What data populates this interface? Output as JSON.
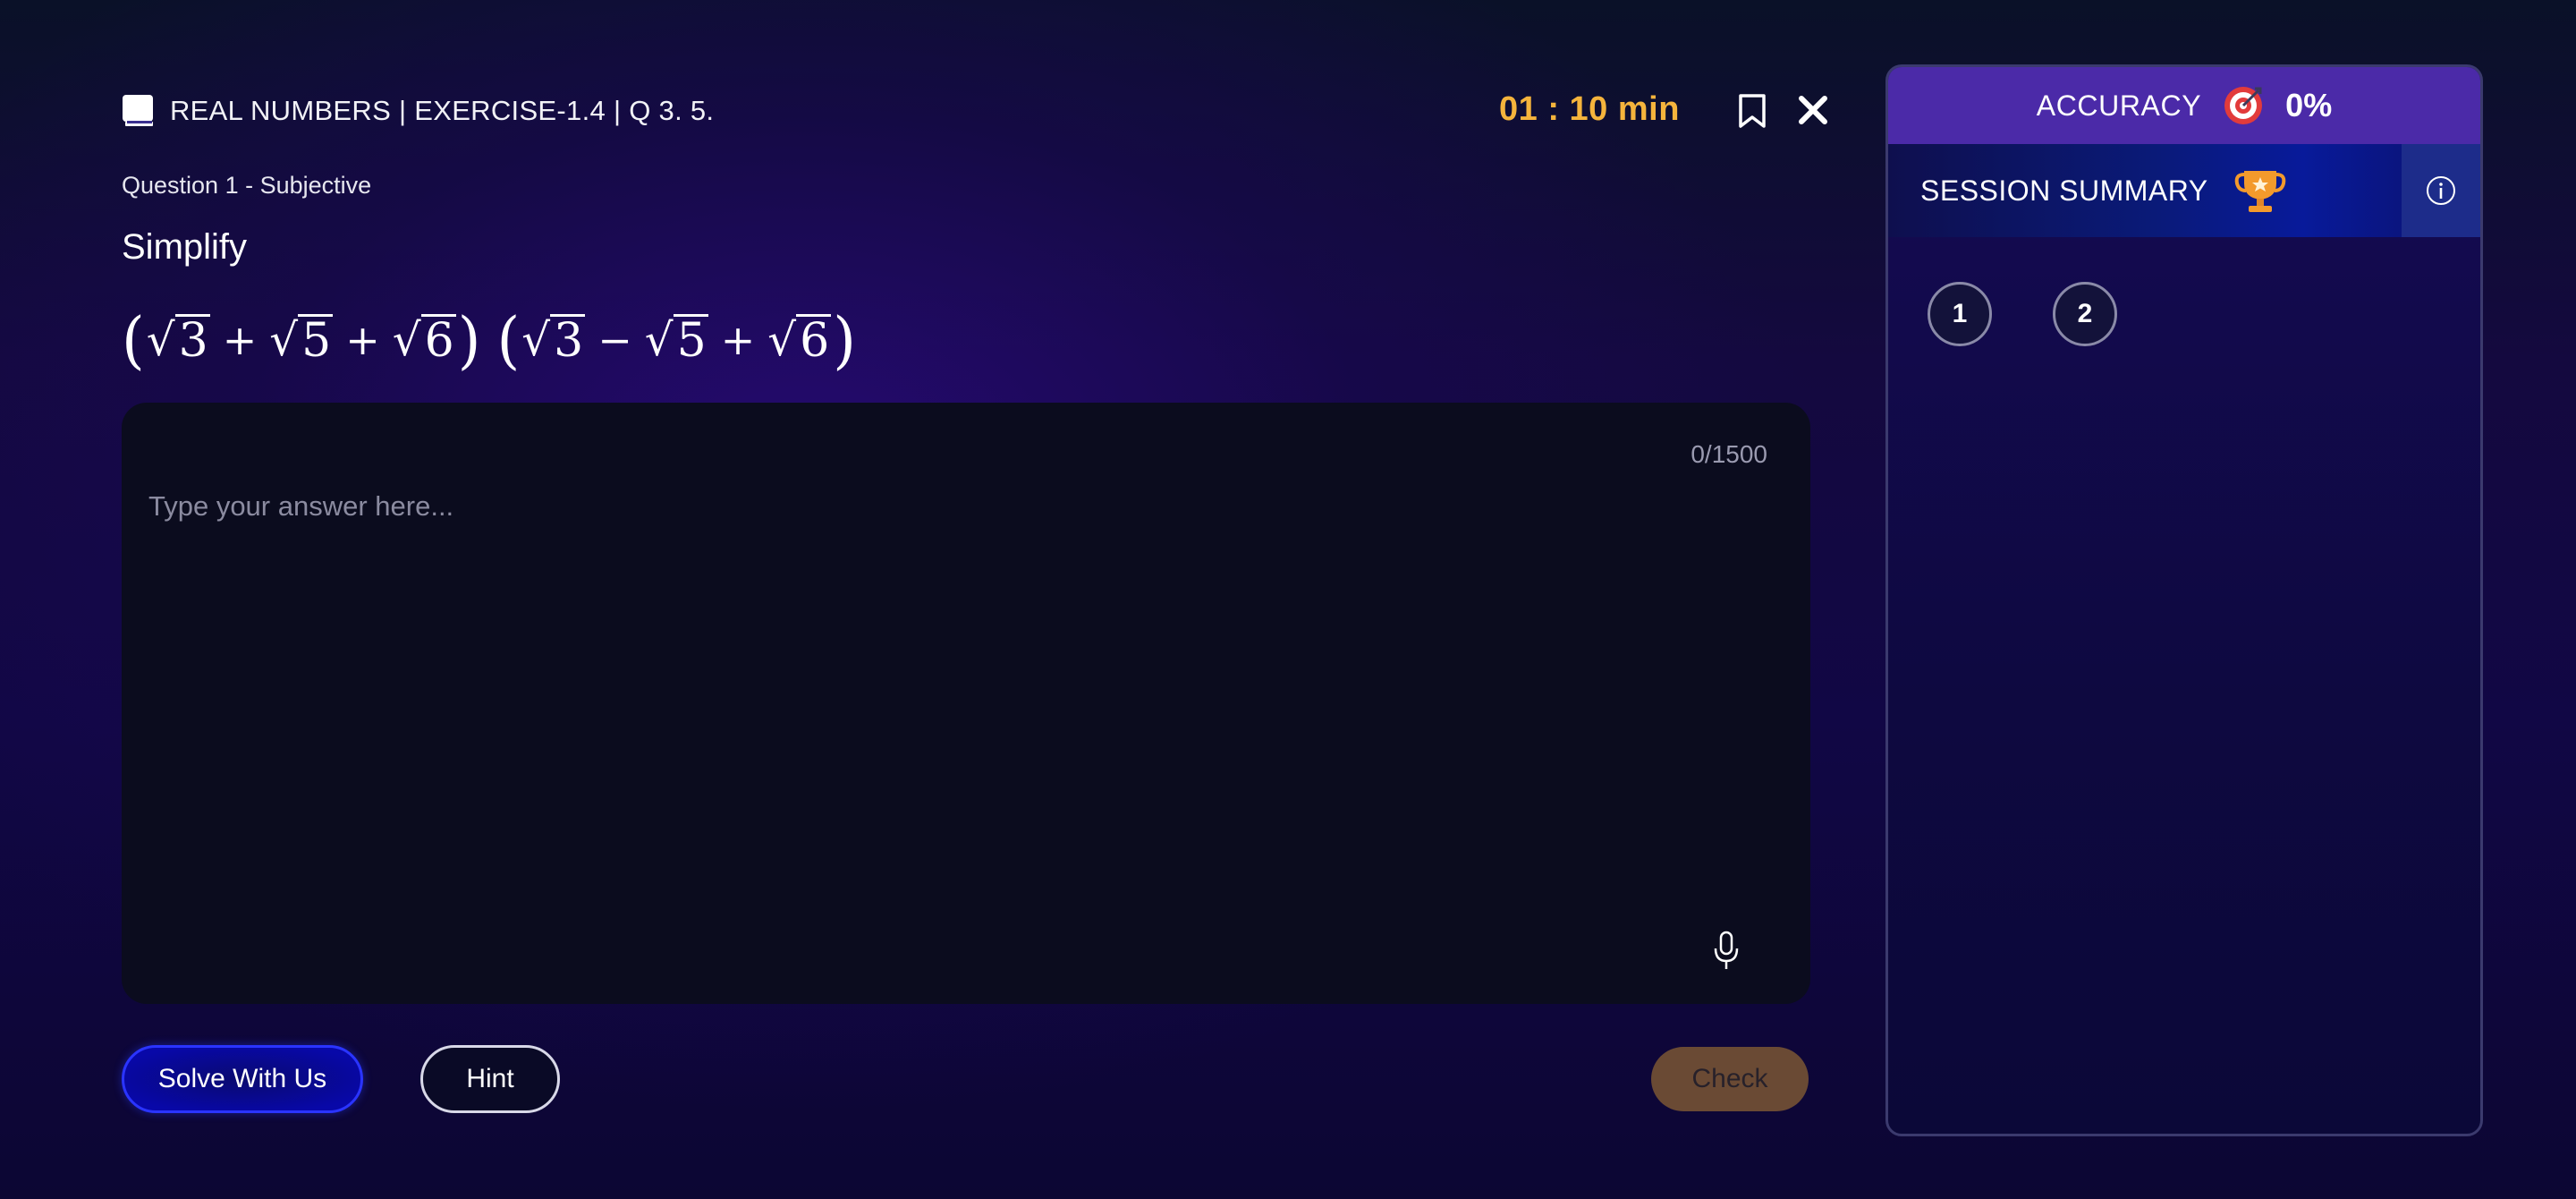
{
  "header": {
    "topic_icon": "book-icon",
    "topic": "REAL NUMBERS | EXERCISE-1.4 | Q 3. 5.",
    "timer": "01 : 10 min",
    "bookmark_icon": "bookmark-icon",
    "close_icon": "close-icon"
  },
  "question": {
    "type_label": "Question 1 - Subjective",
    "prompt": "Simplify",
    "expression": {
      "factor1": {
        "open": "(",
        "terms": [
          "3",
          "5",
          "6"
        ],
        "ops": [
          "+",
          "+"
        ],
        "close": ")"
      },
      "factor2": {
        "open": "(",
        "terms": [
          "3",
          "5",
          "6"
        ],
        "ops": [
          "−",
          "+"
        ],
        "close": ")"
      }
    }
  },
  "answer": {
    "char_count": "0/1500",
    "placeholder": "Type your answer here...",
    "mic_icon": "microphone-icon"
  },
  "actions": {
    "solve_label": "Solve With Us",
    "hint_label": "Hint",
    "check_label": "Check"
  },
  "panel": {
    "accuracy_label": "ACCURACY",
    "accuracy_icon": "target-icon",
    "accuracy_value": "0%",
    "summary_label": "SESSION SUMMARY",
    "summary_icon": "trophy-icon",
    "info_icon": "info-icon",
    "questions": [
      "1",
      "2"
    ]
  },
  "colors": {
    "timer": "#f5b43c",
    "accuracy_bar": "#4b2aa8",
    "solve_border": "#2a34ff",
    "check_bg": "#6a4a34"
  }
}
